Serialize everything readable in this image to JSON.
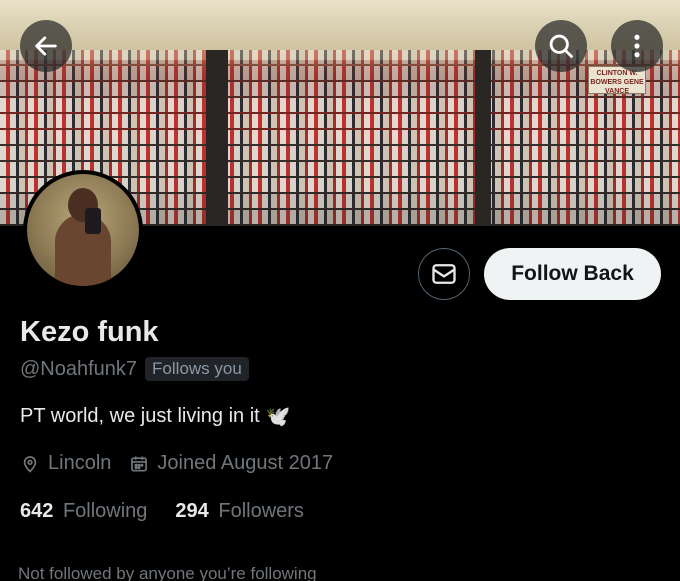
{
  "banner": {
    "sign_text": "CLINTON W. BOWERS GENE VANCE"
  },
  "header": {
    "back_icon": "arrow-left-icon",
    "search_icon": "search-icon",
    "more_icon": "more-vertical-icon"
  },
  "actions": {
    "message_icon": "envelope-icon",
    "follow_label": "Follow Back"
  },
  "profile": {
    "name": "Kezo funk",
    "handle": "@Noahfunk7",
    "follows_you": "Follows you",
    "bio": "PT world, we just living in it",
    "bio_emoji": "🕊️",
    "location": "Lincoln",
    "joined": "Joined August 2017",
    "following_count": "642",
    "following_label": "Following",
    "followers_count": "294",
    "followers_label": "Followers",
    "mutuals_note": "Not followed by anyone you’re following"
  }
}
